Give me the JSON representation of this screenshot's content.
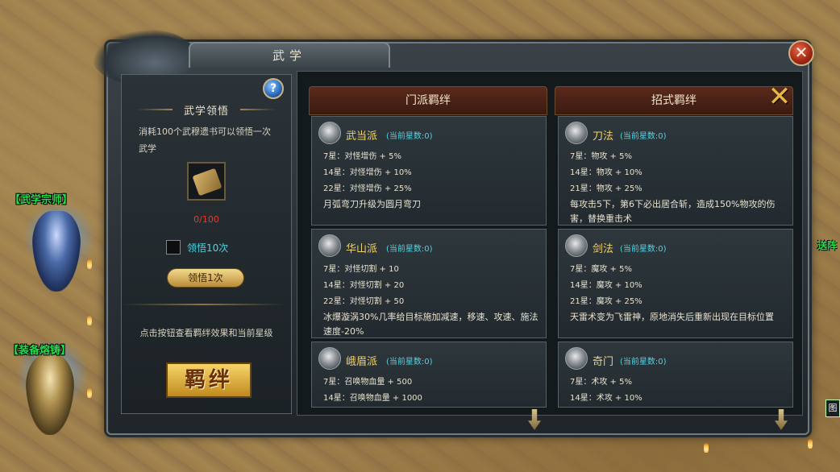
{
  "window": {
    "title": "武学",
    "close_icon": "close-icon"
  },
  "world": {
    "npc1_label": "【武学宗师】",
    "npc2_label": "【装备熔铸】",
    "right_label": "送阵",
    "right_box": "图"
  },
  "left": {
    "help_label": "?",
    "section_title": "武学领悟",
    "description": "消耗100个武穆遗书可以领悟一次武学",
    "item_icon": "scroll-book-icon",
    "count": "0/100",
    "checkbox_label": "领悟10次",
    "comprehend_button": "领悟1次",
    "hint": "点击按钮查看羁绊效果和当前星级",
    "bond_button": "羁绊"
  },
  "tabs": {
    "sect_bond": "门派羁绊",
    "move_bond": "招式羁绊",
    "close_icon": "crossed-swords-close-icon"
  },
  "sect_cards": [
    {
      "name": "武当派",
      "stars": "(当前星数:0)",
      "icon": "wudang-emblem-icon",
      "lines": [
        "7星：对怪增伤 + 5%",
        "14星：对怪增伤 + 10%",
        "22星：对怪增伤 + 25%"
      ],
      "desc": "月弧弯刀升级为圆月弯刀"
    },
    {
      "name": "华山派",
      "stars": "(当前星数:0)",
      "icon": "huashan-emblem-icon",
      "lines": [
        "7星：对怪切割 + 10",
        "14星：对怪切割 + 20",
        "22星：对怪切割 + 50"
      ],
      "desc": "冰爆漩涡30%几率给目标施加减速，移速、攻速、施法速度-20%"
    },
    {
      "name": "峨眉派",
      "stars": "(当前星数:0)",
      "icon": "emei-emblem-icon",
      "lines": [
        "7星：召唤物血量 + 500",
        "14星：召唤物血量 + 1000"
      ],
      "desc": ""
    }
  ],
  "move_cards": [
    {
      "name": "刀法",
      "stars": "(当前星数:0)",
      "icon": "saber-icon",
      "lines": [
        "7星：物攻 + 5%",
        "14星：物攻 + 10%",
        "21星：物攻 + 25%"
      ],
      "desc": "每攻击5下，第6下必出居合斩，造成150%物攻的伤害，替换重击术"
    },
    {
      "name": "剑法",
      "stars": "(当前星数:0)",
      "icon": "sword-icon",
      "lines": [
        "7星：魔攻 + 5%",
        "14星：魔攻 + 10%",
        "21星：魔攻 + 25%"
      ],
      "desc": "天雷术变为飞雷神，原地消失后重新出现在目标位置"
    },
    {
      "name": "奇门",
      "stars": "(当前星数:0)",
      "icon": "bagua-icon",
      "lines": [
        "7星：术攻 + 5%",
        "14星：术攻 + 10%"
      ],
      "desc": ""
    }
  ]
}
